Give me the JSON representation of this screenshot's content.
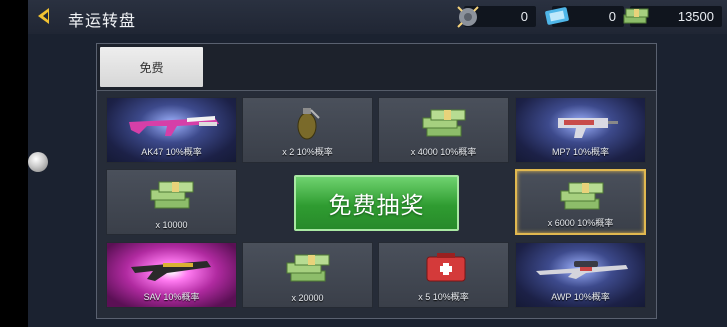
{
  "header": {
    "title": "幸运转盘",
    "currencies": [
      {
        "icon": "gear-token-icon",
        "value": "0"
      },
      {
        "icon": "ticket-icon",
        "value": "0"
      },
      {
        "icon": "cash-icon",
        "value": "13500"
      }
    ]
  },
  "tabs": [
    {
      "label": "免费"
    }
  ],
  "cells": [
    {
      "label": "AK47 10%概率",
      "icon": "ak47-rifle-icon"
    },
    {
      "label": "x 2 10%概率",
      "icon": "grenade-icon"
    },
    {
      "label": "x 4000 10%概率",
      "icon": "cash-stack-icon"
    },
    {
      "label": "MP7 10%概率",
      "icon": "mp7-smg-icon"
    },
    {
      "label": "x 10000",
      "icon": "cash-stack-icon"
    },
    {
      "label": "x 6000 10%概率",
      "icon": "cash-stack-icon"
    },
    {
      "label": "SAV 10%概率",
      "icon": "shotgun-icon"
    },
    {
      "label": "x 20000",
      "icon": "cash-stack-icon"
    },
    {
      "label": "x 5 10%概率",
      "icon": "medkit-icon"
    },
    {
      "label": "AWP 10%概率",
      "icon": "awp-sniper-icon"
    }
  ],
  "draw_button": {
    "label": "免费抽奖"
  },
  "colors": {
    "accent_gold": "#e1b850",
    "draw_green": "#2f9c31",
    "back_arrow": "#f1c232"
  }
}
